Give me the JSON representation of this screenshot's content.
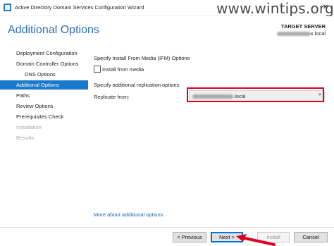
{
  "window": {
    "title": "Active Directory Domain Services Configuration Wizard",
    "watermark": "www.wintips.org",
    "close_glyph": "✕"
  },
  "header": {
    "page_title": "Additional Options",
    "target_label": "TARGET SERVER",
    "target_suffix": "x.local"
  },
  "sidebar": {
    "items": [
      {
        "label": "Deployment Configuration",
        "state": "normal",
        "level": 0
      },
      {
        "label": "Domain Controller Options",
        "state": "normal",
        "level": 0
      },
      {
        "label": "DNS Options",
        "state": "normal",
        "level": 1
      },
      {
        "label": "Additional Options",
        "state": "active",
        "level": 0
      },
      {
        "label": "Paths",
        "state": "normal",
        "level": 0
      },
      {
        "label": "Review Options",
        "state": "normal",
        "level": 0
      },
      {
        "label": "Prerequisites Check",
        "state": "normal",
        "level": 0
      },
      {
        "label": "Installation",
        "state": "disabled",
        "level": 0
      },
      {
        "label": "Results",
        "state": "disabled",
        "level": 0
      }
    ]
  },
  "main": {
    "ifm_heading": "Specify Install From Media (IFM) Options",
    "ifm_checkbox_label": "Install from media",
    "ifm_checked": false,
    "replication_heading": "Specify additional replication options",
    "replicate_label": "Replicate from:",
    "replicate_value_suffix": ".local",
    "more_link": "More about additional options"
  },
  "footer": {
    "previous": "< Previous",
    "next": "Next >",
    "install": "Install",
    "cancel": "Cancel"
  },
  "colors": {
    "accent": "#1979ca",
    "title_blue": "#2a6fb8",
    "highlight_red": "#e0001b"
  }
}
